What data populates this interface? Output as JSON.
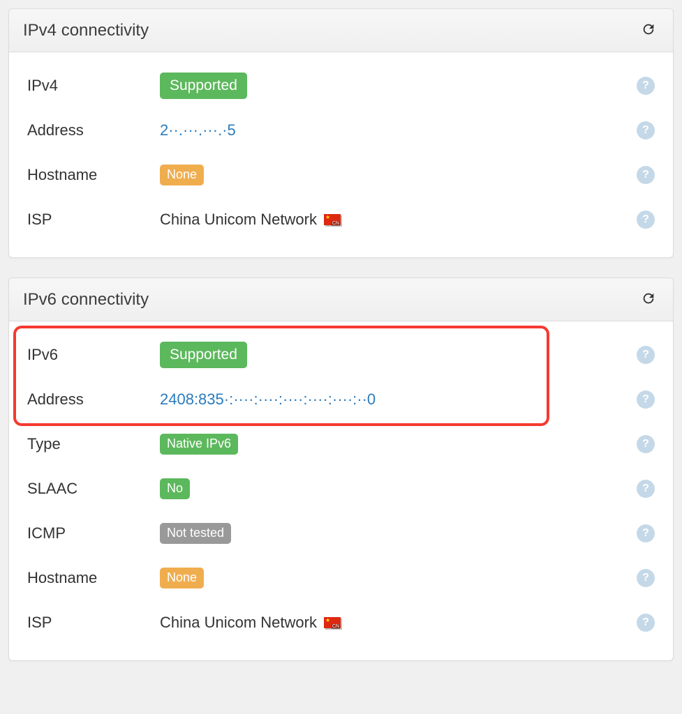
{
  "panels": {
    "ipv4": {
      "title": "IPv4 connectivity",
      "rows": {
        "status": {
          "label": "IPv4",
          "badge": "Supported",
          "badgeColor": "green"
        },
        "address": {
          "label": "Address",
          "link": "2··.···.···.·5"
        },
        "hostname": {
          "label": "Hostname",
          "badge": "None",
          "badgeColor": "orange",
          "badgeSize": "sm"
        },
        "isp": {
          "label": "ISP",
          "text": "China Unicom Network",
          "flag": "cn"
        }
      }
    },
    "ipv6": {
      "title": "IPv6 connectivity",
      "rows": {
        "status": {
          "label": "IPv6",
          "badge": "Supported",
          "badgeColor": "green"
        },
        "address": {
          "label": "Address",
          "link": "2408:835·:····:····:····:····:····:··0"
        },
        "type": {
          "label": "Type",
          "badge": "Native IPv6",
          "badgeColor": "green",
          "badgeSize": "sm"
        },
        "slaac": {
          "label": "SLAAC",
          "badge": "No",
          "badgeColor": "green",
          "badgeSize": "sm"
        },
        "icmp": {
          "label": "ICMP",
          "badge": "Not tested",
          "badgeColor": "gray",
          "badgeSize": "sm"
        },
        "hostname": {
          "label": "Hostname",
          "badge": "None",
          "badgeColor": "orange",
          "badgeSize": "sm"
        },
        "isp": {
          "label": "ISP",
          "text": "China Unicom Network",
          "flag": "cn"
        }
      }
    }
  }
}
